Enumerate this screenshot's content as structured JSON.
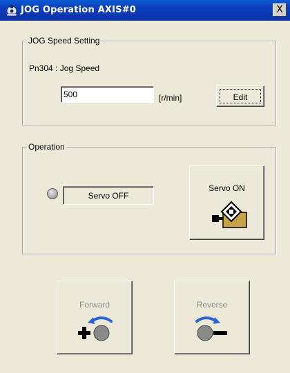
{
  "window": {
    "title": "JOG Operation AXIS#0",
    "close_symbol": "X"
  },
  "jog_speed": {
    "group_label": "JOG Speed Setting",
    "param_label": "Pn304 : Jog Speed",
    "value": "500",
    "unit": "[r/min]",
    "edit_label": "Edit"
  },
  "operation": {
    "group_label": "Operation",
    "status_text": "Servo OFF",
    "servo_button_label": "Servo ON"
  },
  "jog": {
    "forward_label": "Forward",
    "reverse_label": "Reverse"
  },
  "colors": {
    "title_bar": "#0a5bd3",
    "face": "#ece9d8",
    "disabled_text": "#8d8d8d",
    "arrow_blue": "#2a63d8"
  }
}
